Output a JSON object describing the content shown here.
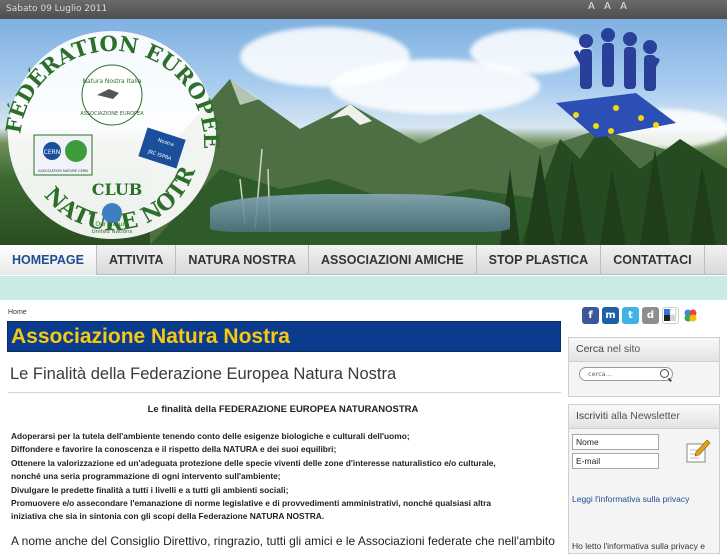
{
  "topbar": {
    "date": "Sabato 09 Luglio 2011",
    "font_size_controls": [
      "A",
      "A",
      "A"
    ]
  },
  "banner": {
    "logo_ring_text_top": "FÉDÉRATION EUROPÉENNE",
    "logo_ring_text_bottom": "NATURE NOTRE",
    "logo_club": "CLUB",
    "logo_center_1": "Natura Nostra Italia",
    "logo_center_2": "ASSOCIAZIONE EUROPEA",
    "logo_badge_cern": "CERN",
    "logo_badge_cern_sub": "ASSOCIATION NATURE CERN",
    "logo_badge_jrc_1": "Nostra",
    "logo_badge_jrc_2": "JRC ISPRA",
    "logo_un_1": "Our Nature",
    "logo_un_2": "United Nations"
  },
  "nav": {
    "items": [
      "HOMEPAGE",
      "ATTIVITA",
      "NATURA NOSTRA",
      "ASSOCIAZIONI AMICHE",
      "STOP PLASTICA",
      "CONTATTACI"
    ]
  },
  "main": {
    "breadcrumb": "Home",
    "section_title": "Associazione Natura Nostra",
    "article_title": "Le Finalità della Federazione Europea Natura Nostra",
    "subtitle": "Le finalità della FEDERAZIONE EUROPEA NATURANOSTRA",
    "lines": [
      "Adoperarsi per la tutela dell'ambiente tenendo conto delle esigenze biologiche e culturali dell'uomo;",
      "Diffondere e favorire la conoscenza e il rispetto della NATURA e dei suoi equilibri;",
      "Ottenere la valorizzazione ed un'adeguata protezione delle specie viventi delle zone d'interesse naturalistico e/o culturale,",
      "nonché una seria programmazione di ogni intervento sull'ambiente;",
      "Divulgare le predette finalità a tutti i livelli e a tutti gli ambienti sociali;",
      "Promuovere e/o assecondare l'emanazione di norme legislative e di provvedimenti amministrativi, nonché qualsiasi altra",
      "iniziativa che sia in sintonia con gli scopi della Federazione NATURA NOSTRA."
    ],
    "cut_line": "A nome anche del Consiglio Direttivo, ringrazio, tutti gli amici e le Associazioni federate che nell'ambito"
  },
  "sidebar": {
    "social_icons": [
      "facebook-icon",
      "myspace-icon",
      "twitter-icon",
      "digg-icon",
      "delicious-icon",
      "google-icon"
    ],
    "search": {
      "title_1": "Cerca",
      "title_2": "nel sito",
      "placeholder": "cerca..."
    },
    "newsletter": {
      "title_1": "Iscriviti",
      "title_2": "alla Newsletter",
      "name_value": "Nome",
      "email_value": "E-mail",
      "privacy_link": "Leggi l'informativa sulla privacy",
      "privacy_consent": "Ho letto l'informativa sulla privacy e"
    }
  },
  "colors": {
    "title_bg": "#0a3b8c",
    "title_text": "#f7c911",
    "band": "#c9ebe6",
    "nav_active": "#1d4f91"
  }
}
